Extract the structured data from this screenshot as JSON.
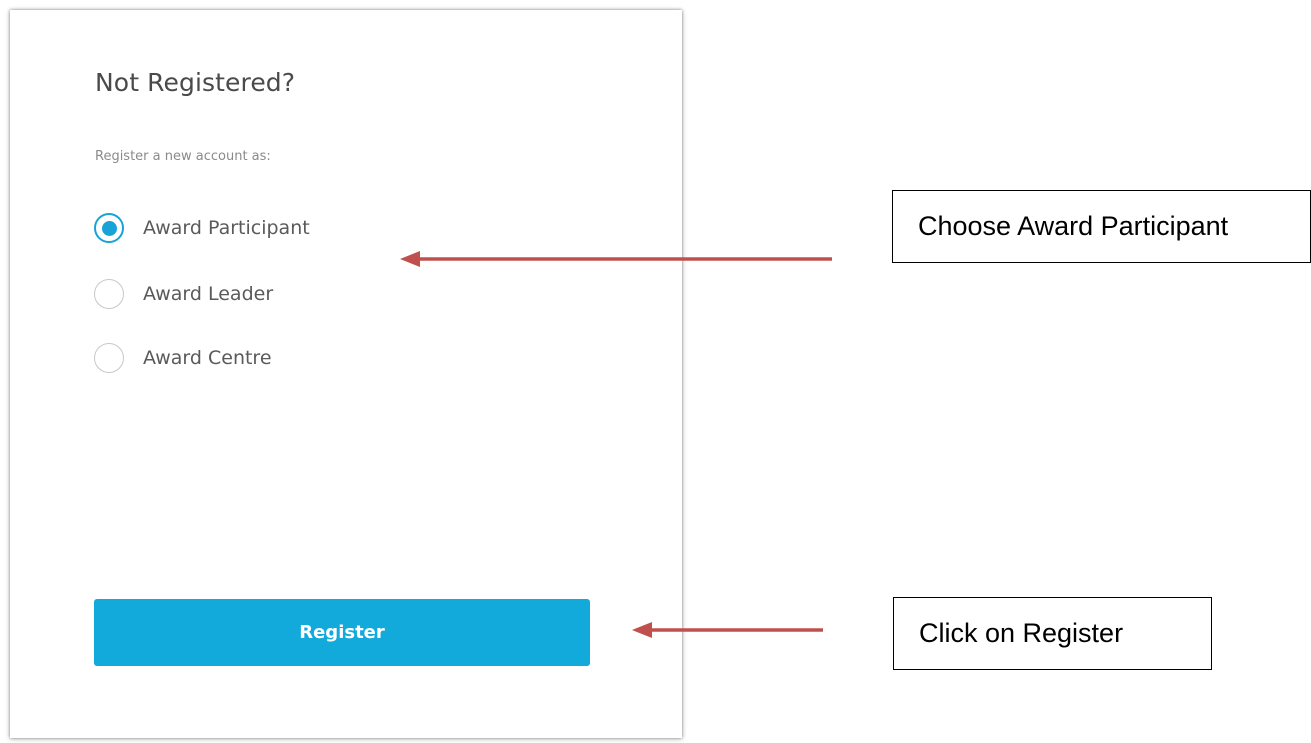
{
  "panel": {
    "title": "Not Registered?",
    "subtitle": "Register a new account as:",
    "options": [
      {
        "label": "Award Participant",
        "checked": true
      },
      {
        "label": "Award Leader",
        "checked": false
      },
      {
        "label": "Award Centre",
        "checked": false
      }
    ],
    "register_label": "Register"
  },
  "annotations": {
    "choose_text": "Choose Award Participant",
    "click_text": "Click on Register"
  },
  "colors": {
    "accent": "#18a3d8",
    "button": "#12a9db",
    "arrow": "#c0504d"
  }
}
